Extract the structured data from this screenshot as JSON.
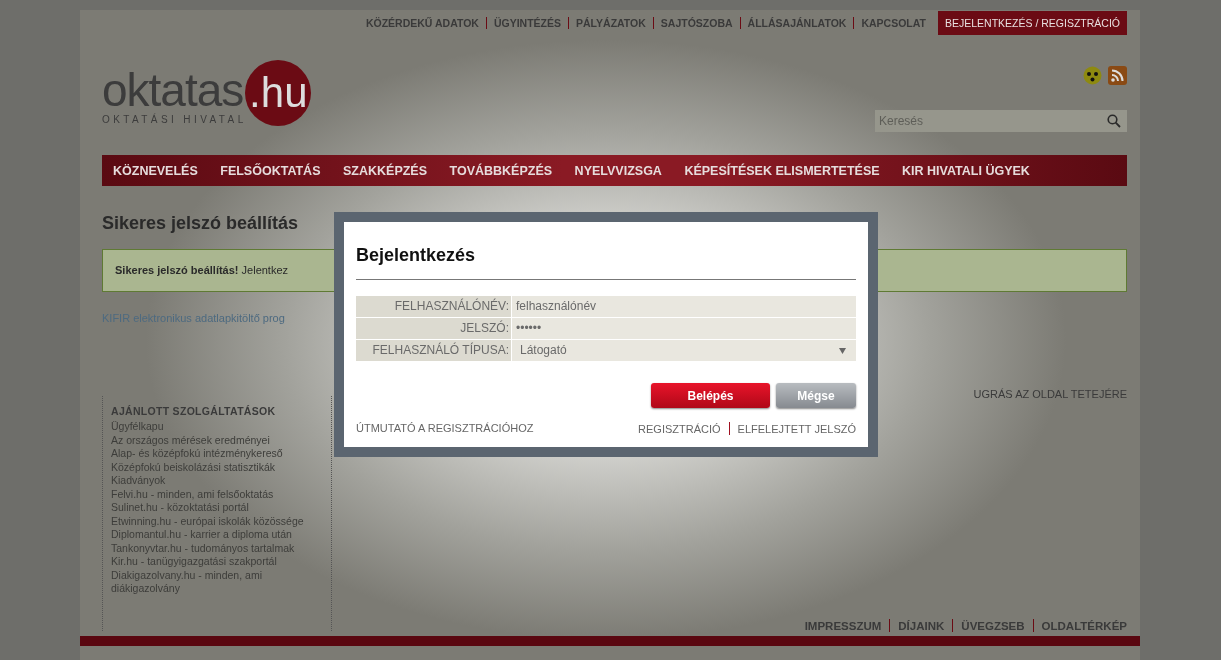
{
  "top_links": [
    "KÖZÉRDEKŰ ADATOK",
    "ÜGYINTÉZÉS",
    "PÁLYÁZATOK",
    "SAJTÓSZOBA",
    "ÁLLÁSAJÁNLATOK",
    "KAPCSOLAT"
  ],
  "login_link": "BEJELENTKEZÉS / REGISZTRÁCIÓ",
  "logo": {
    "wordmark": "oktatas",
    "domain": ".hu",
    "subtitle": "OKTATÁSI HIVATAL"
  },
  "search": {
    "placeholder": "Keresés"
  },
  "nav": [
    "KÖZNEVELÉS",
    "FELSŐOKTATÁS",
    "SZAKKÉPZÉS",
    "TOVÁBBKÉPZÉS",
    "NYELVVIZSGA",
    "KÉPESÍTÉSEK ELISMERTETÉSE",
    "KIR HIVATALI ÜGYEK"
  ],
  "page": {
    "heading": "Sikeres jelszó beállítás",
    "alert": "**Sikeres jelszó beállítás!** Jelentkez",
    "link": "KIFIR elektronikus adatlapkitöltő prog"
  },
  "modal": {
    "title": "Bejelentkezés",
    "fields": [
      {
        "label": "FELHASZNÁLÓNÉV:",
        "value": "felhasználónév",
        "kind": "text"
      },
      {
        "label": "JELSZÓ:",
        "value": "••••••",
        "kind": "password"
      },
      {
        "label": "FELHASZNÁLÓ TÍPUSA:",
        "value": "Látogató",
        "kind": "select"
      }
    ],
    "buttons": [
      {
        "label": "Belépés",
        "kind": "primary"
      },
      {
        "label": "Mégse",
        "kind": "secondary"
      }
    ],
    "guide_link": "ÚTMUTATÓ A REGISZTRÁCIÓHOZ",
    "links": [
      "REGISZTRÁCIÓ",
      "ELFELEJTETT JELSZÓ"
    ]
  },
  "footer": {
    "services_title": "AJÁNLOTT SZOLGÁLTATÁSOK",
    "services": [
      "Ügyfélkapu",
      "Az országos mérések eredményei",
      "Alap- és középfokú intézménykereső",
      "Középfokú beiskolázási statisztikák",
      "Kiadványok",
      "Felvi.hu - minden, ami felsőoktatás",
      "Sulinet.hu - közoktatási portál",
      "Etwinning.hu - európai iskolák közössége",
      "Diplomantul.hu - karrier a diploma után",
      "Tankonyvtar.hu - tudományos tartalmak",
      "Kir.hu - tanügyigazgatási szakportál",
      "Diakigazolvany.hu - minden, ami diákigazolvány"
    ],
    "back_to_top": "UGRÁS AZ OLDAL TETEJÉRE",
    "links": [
      "IMPRESSZUM",
      "DÍJAINK",
      "ÜVEGZSEB",
      "OLDALTÉRKÉP"
    ]
  }
}
